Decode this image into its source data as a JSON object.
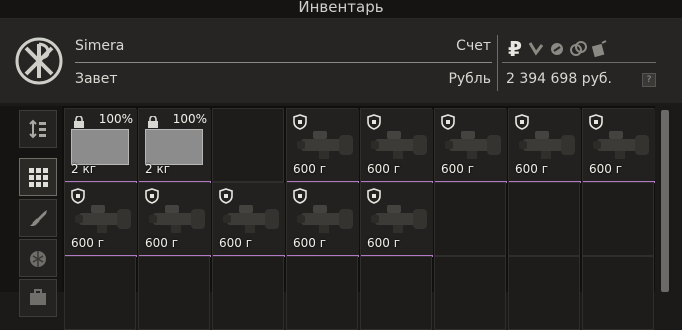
{
  "title": "Инвентарь",
  "header": {
    "name": "Simera",
    "faction": "Завет",
    "account_label": "Счет",
    "currency_label": "Рубль",
    "balance": "2 394 698 руб.",
    "help": "?"
  },
  "currency_icons": [
    "ruble-icon",
    "dollar-icon",
    "euro-icon",
    "bitcoin-icon",
    "gp-icon"
  ],
  "filters": [
    {
      "name": "sort-icon",
      "active": false
    },
    {
      "name": "all-items-icon",
      "active": true
    },
    {
      "name": "weapons-icon",
      "active": false
    },
    {
      "name": "grenade-icon",
      "active": false
    },
    {
      "name": "gear-icon",
      "active": false
    }
  ],
  "grid": {
    "columns": 8,
    "rows": 2,
    "items": [
      {
        "type": "case",
        "col": 0,
        "row": 0,
        "percent": "100%",
        "weight": "2 кг"
      },
      {
        "type": "case",
        "col": 1,
        "row": 0,
        "percent": "100%",
        "weight": "2 кг"
      },
      {
        "type": "scope",
        "col": 3,
        "row": 0,
        "weight": "600 г"
      },
      {
        "type": "scope",
        "col": 4,
        "row": 0,
        "weight": "600 г"
      },
      {
        "type": "scope",
        "col": 5,
        "row": 0,
        "weight": "600 г"
      },
      {
        "type": "scope",
        "col": 6,
        "row": 0,
        "weight": "600 г"
      },
      {
        "type": "scope",
        "col": 7,
        "row": 0,
        "weight": "600 г"
      },
      {
        "type": "scope",
        "col": 0,
        "row": 1,
        "weight": "600 г"
      },
      {
        "type": "scope",
        "col": 1,
        "row": 1,
        "weight": "600 г"
      },
      {
        "type": "scope",
        "col": 2,
        "row": 1,
        "weight": "600 г"
      },
      {
        "type": "scope",
        "col": 3,
        "row": 1,
        "weight": "600 г"
      },
      {
        "type": "scope",
        "col": 4,
        "row": 1,
        "weight": "600 г"
      }
    ]
  }
}
